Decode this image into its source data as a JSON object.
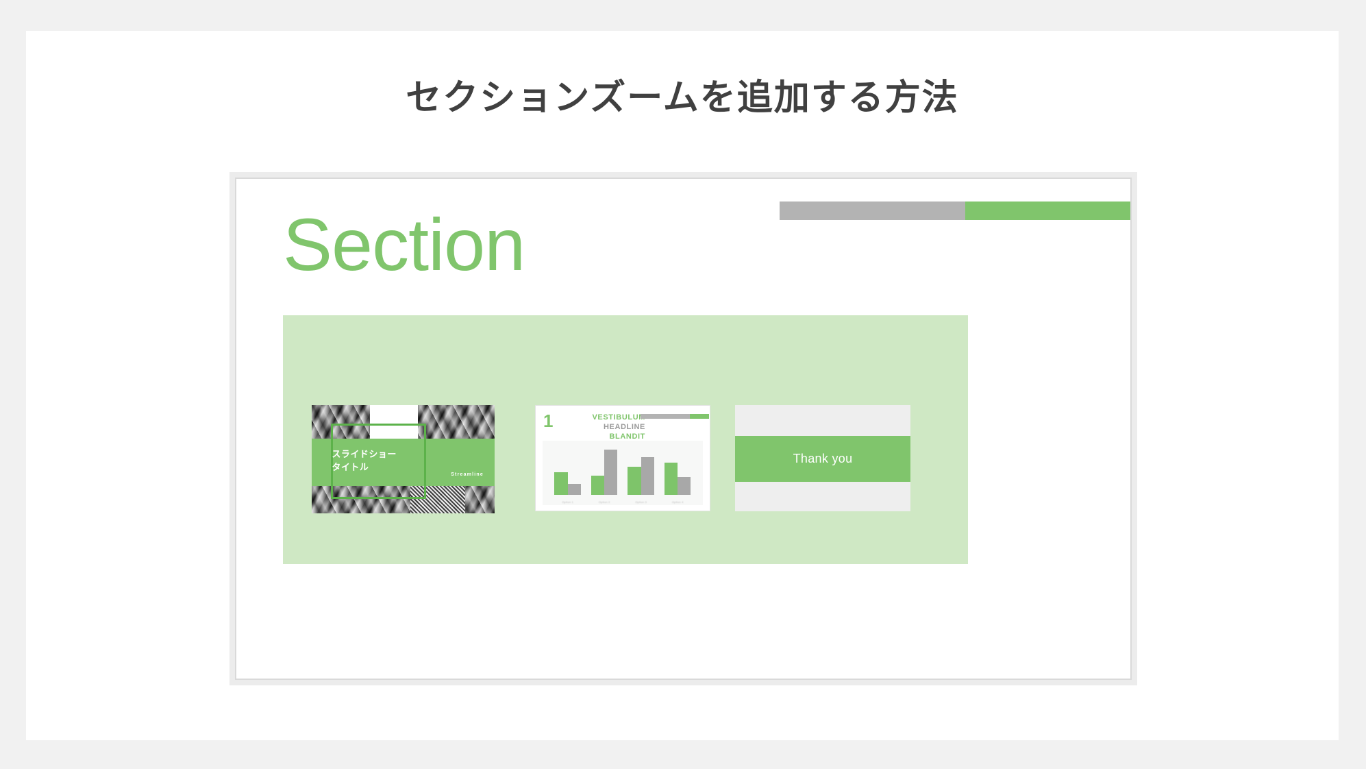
{
  "page": {
    "title": "セクションズームを追加する方法",
    "background_color": "#f1f1f1",
    "card_color": "#ffffff",
    "title_color": "#404040"
  },
  "theme": {
    "green": "#80c56c",
    "green_dark": "#5cb24a",
    "green_light": "#cfe8c4",
    "gray": "#b3b3b3",
    "gray_bar": "#a8a8a8",
    "light_gray": "#eeeeee"
  },
  "slide": {
    "section_word": "Section",
    "progress_bar": {
      "gray_percent": 53,
      "green_percent": 47
    }
  },
  "thumbnails": [
    {
      "kind": "title-slide",
      "title_line_1": "スライドショー",
      "title_line_2": "タイトル",
      "brand": "Streamline"
    },
    {
      "kind": "chart-slide",
      "number": "1",
      "headline_line_1": "VESTIBULUM",
      "headline_line_2": "HEADLINE",
      "headline_line_3": "BLANDIT",
      "progress_bar": {
        "gray_percent": 72,
        "green_percent": 28
      },
      "chart_data": {
        "type": "bar",
        "title": "",
        "xlabel": "",
        "ylabel": "",
        "ylim": [
          0,
          100
        ],
        "grid": false,
        "legend": "none",
        "categories": [
          "Option 1",
          "Option 2",
          "Option 3",
          "Option 4"
        ],
        "series": [
          {
            "name": "Green",
            "color": "#7ec46a",
            "values": [
              45,
              38,
              56,
              65
            ]
          },
          {
            "name": "Gray",
            "color": "#a8a8a8",
            "values": [
              22,
              90,
              76,
              36
            ]
          }
        ]
      }
    },
    {
      "kind": "thank-you-slide",
      "text": "Thank you"
    }
  ]
}
